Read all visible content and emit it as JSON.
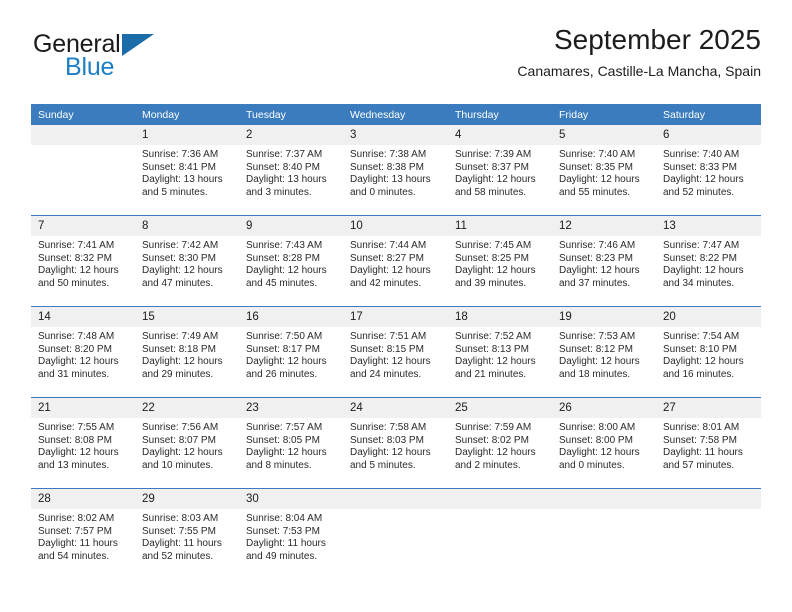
{
  "brand": {
    "word1": "General",
    "word2": "Blue",
    "logo_icon": "triangle-logo-icon",
    "accent_color": "#1c7fc4"
  },
  "header": {
    "title": "September 2025",
    "subtitle": "Canamares, Castille-La Mancha, Spain"
  },
  "calendar": {
    "header_color": "#3a7cbe",
    "weekday_headers": [
      "Sunday",
      "Monday",
      "Tuesday",
      "Wednesday",
      "Thursday",
      "Friday",
      "Saturday"
    ],
    "weeks": [
      [
        {
          "day": "",
          "sunrise": "",
          "sunset": "",
          "daylight_1": "",
          "daylight_2": ""
        },
        {
          "day": "1",
          "sunrise": "Sunrise: 7:36 AM",
          "sunset": "Sunset: 8:41 PM",
          "daylight_1": "Daylight: 13 hours",
          "daylight_2": "and 5 minutes."
        },
        {
          "day": "2",
          "sunrise": "Sunrise: 7:37 AM",
          "sunset": "Sunset: 8:40 PM",
          "daylight_1": "Daylight: 13 hours",
          "daylight_2": "and 3 minutes."
        },
        {
          "day": "3",
          "sunrise": "Sunrise: 7:38 AM",
          "sunset": "Sunset: 8:38 PM",
          "daylight_1": "Daylight: 13 hours",
          "daylight_2": "and 0 minutes."
        },
        {
          "day": "4",
          "sunrise": "Sunrise: 7:39 AM",
          "sunset": "Sunset: 8:37 PM",
          "daylight_1": "Daylight: 12 hours",
          "daylight_2": "and 58 minutes."
        },
        {
          "day": "5",
          "sunrise": "Sunrise: 7:40 AM",
          "sunset": "Sunset: 8:35 PM",
          "daylight_1": "Daylight: 12 hours",
          "daylight_2": "and 55 minutes."
        },
        {
          "day": "6",
          "sunrise": "Sunrise: 7:40 AM",
          "sunset": "Sunset: 8:33 PM",
          "daylight_1": "Daylight: 12 hours",
          "daylight_2": "and 52 minutes."
        }
      ],
      [
        {
          "day": "7",
          "sunrise": "Sunrise: 7:41 AM",
          "sunset": "Sunset: 8:32 PM",
          "daylight_1": "Daylight: 12 hours",
          "daylight_2": "and 50 minutes."
        },
        {
          "day": "8",
          "sunrise": "Sunrise: 7:42 AM",
          "sunset": "Sunset: 8:30 PM",
          "daylight_1": "Daylight: 12 hours",
          "daylight_2": "and 47 minutes."
        },
        {
          "day": "9",
          "sunrise": "Sunrise: 7:43 AM",
          "sunset": "Sunset: 8:28 PM",
          "daylight_1": "Daylight: 12 hours",
          "daylight_2": "and 45 minutes."
        },
        {
          "day": "10",
          "sunrise": "Sunrise: 7:44 AM",
          "sunset": "Sunset: 8:27 PM",
          "daylight_1": "Daylight: 12 hours",
          "daylight_2": "and 42 minutes."
        },
        {
          "day": "11",
          "sunrise": "Sunrise: 7:45 AM",
          "sunset": "Sunset: 8:25 PM",
          "daylight_1": "Daylight: 12 hours",
          "daylight_2": "and 39 minutes."
        },
        {
          "day": "12",
          "sunrise": "Sunrise: 7:46 AM",
          "sunset": "Sunset: 8:23 PM",
          "daylight_1": "Daylight: 12 hours",
          "daylight_2": "and 37 minutes."
        },
        {
          "day": "13",
          "sunrise": "Sunrise: 7:47 AM",
          "sunset": "Sunset: 8:22 PM",
          "daylight_1": "Daylight: 12 hours",
          "daylight_2": "and 34 minutes."
        }
      ],
      [
        {
          "day": "14",
          "sunrise": "Sunrise: 7:48 AM",
          "sunset": "Sunset: 8:20 PM",
          "daylight_1": "Daylight: 12 hours",
          "daylight_2": "and 31 minutes."
        },
        {
          "day": "15",
          "sunrise": "Sunrise: 7:49 AM",
          "sunset": "Sunset: 8:18 PM",
          "daylight_1": "Daylight: 12 hours",
          "daylight_2": "and 29 minutes."
        },
        {
          "day": "16",
          "sunrise": "Sunrise: 7:50 AM",
          "sunset": "Sunset: 8:17 PM",
          "daylight_1": "Daylight: 12 hours",
          "daylight_2": "and 26 minutes."
        },
        {
          "day": "17",
          "sunrise": "Sunrise: 7:51 AM",
          "sunset": "Sunset: 8:15 PM",
          "daylight_1": "Daylight: 12 hours",
          "daylight_2": "and 24 minutes."
        },
        {
          "day": "18",
          "sunrise": "Sunrise: 7:52 AM",
          "sunset": "Sunset: 8:13 PM",
          "daylight_1": "Daylight: 12 hours",
          "daylight_2": "and 21 minutes."
        },
        {
          "day": "19",
          "sunrise": "Sunrise: 7:53 AM",
          "sunset": "Sunset: 8:12 PM",
          "daylight_1": "Daylight: 12 hours",
          "daylight_2": "and 18 minutes."
        },
        {
          "day": "20",
          "sunrise": "Sunrise: 7:54 AM",
          "sunset": "Sunset: 8:10 PM",
          "daylight_1": "Daylight: 12 hours",
          "daylight_2": "and 16 minutes."
        }
      ],
      [
        {
          "day": "21",
          "sunrise": "Sunrise: 7:55 AM",
          "sunset": "Sunset: 8:08 PM",
          "daylight_1": "Daylight: 12 hours",
          "daylight_2": "and 13 minutes."
        },
        {
          "day": "22",
          "sunrise": "Sunrise: 7:56 AM",
          "sunset": "Sunset: 8:07 PM",
          "daylight_1": "Daylight: 12 hours",
          "daylight_2": "and 10 minutes."
        },
        {
          "day": "23",
          "sunrise": "Sunrise: 7:57 AM",
          "sunset": "Sunset: 8:05 PM",
          "daylight_1": "Daylight: 12 hours",
          "daylight_2": "and 8 minutes."
        },
        {
          "day": "24",
          "sunrise": "Sunrise: 7:58 AM",
          "sunset": "Sunset: 8:03 PM",
          "daylight_1": "Daylight: 12 hours",
          "daylight_2": "and 5 minutes."
        },
        {
          "day": "25",
          "sunrise": "Sunrise: 7:59 AM",
          "sunset": "Sunset: 8:02 PM",
          "daylight_1": "Daylight: 12 hours",
          "daylight_2": "and 2 minutes."
        },
        {
          "day": "26",
          "sunrise": "Sunrise: 8:00 AM",
          "sunset": "Sunset: 8:00 PM",
          "daylight_1": "Daylight: 12 hours",
          "daylight_2": "and 0 minutes."
        },
        {
          "day": "27",
          "sunrise": "Sunrise: 8:01 AM",
          "sunset": "Sunset: 7:58 PM",
          "daylight_1": "Daylight: 11 hours",
          "daylight_2": "and 57 minutes."
        }
      ],
      [
        {
          "day": "28",
          "sunrise": "Sunrise: 8:02 AM",
          "sunset": "Sunset: 7:57 PM",
          "daylight_1": "Daylight: 11 hours",
          "daylight_2": "and 54 minutes."
        },
        {
          "day": "29",
          "sunrise": "Sunrise: 8:03 AM",
          "sunset": "Sunset: 7:55 PM",
          "daylight_1": "Daylight: 11 hours",
          "daylight_2": "and 52 minutes."
        },
        {
          "day": "30",
          "sunrise": "Sunrise: 8:04 AM",
          "sunset": "Sunset: 7:53 PM",
          "daylight_1": "Daylight: 11 hours",
          "daylight_2": "and 49 minutes."
        },
        {
          "day": "",
          "sunrise": "",
          "sunset": "",
          "daylight_1": "",
          "daylight_2": ""
        },
        {
          "day": "",
          "sunrise": "",
          "sunset": "",
          "daylight_1": "",
          "daylight_2": ""
        },
        {
          "day": "",
          "sunrise": "",
          "sunset": "",
          "daylight_1": "",
          "daylight_2": ""
        },
        {
          "day": "",
          "sunrise": "",
          "sunset": "",
          "daylight_1": "",
          "daylight_2": ""
        }
      ]
    ]
  }
}
